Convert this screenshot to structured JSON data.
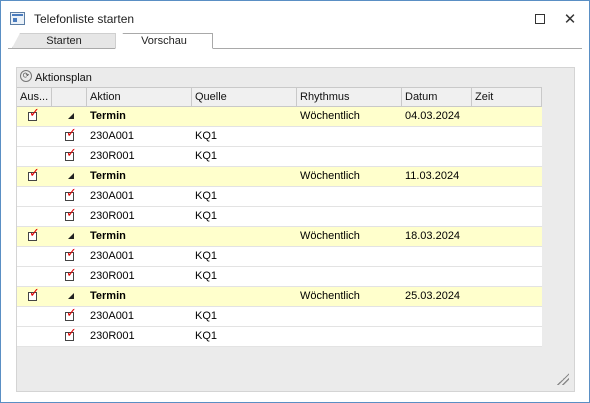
{
  "window": {
    "title": "Telefonliste starten",
    "maximize_icon": "maximize-icon",
    "close_icon": "close-icon",
    "close_glyph": "✕"
  },
  "tabs": [
    {
      "label": "Starten",
      "active": false
    },
    {
      "label": "Vorschau",
      "active": true
    }
  ],
  "panel": {
    "title": "Aktionsplan",
    "icon": "actionplan-icon"
  },
  "grid": {
    "headers": [
      "Aus...",
      "",
      "Aktion",
      "Quelle",
      "Rhythmus",
      "Datum",
      "Zeit"
    ],
    "groups": [
      {
        "checked": true,
        "aktion": "Termin",
        "rhythmus": "Wöchentlich",
        "datum": "04.03.2024",
        "items": [
          {
            "checked": true,
            "aktion": "230A001",
            "quelle": "KQ1"
          },
          {
            "checked": true,
            "aktion": "230R001",
            "quelle": "KQ1"
          }
        ]
      },
      {
        "checked": true,
        "aktion": "Termin",
        "rhythmus": "Wöchentlich",
        "datum": "11.03.2024",
        "items": [
          {
            "checked": true,
            "aktion": "230A001",
            "quelle": "KQ1"
          },
          {
            "checked": true,
            "aktion": "230R001",
            "quelle": "KQ1"
          }
        ]
      },
      {
        "checked": true,
        "aktion": "Termin",
        "rhythmus": "Wöchentlich",
        "datum": "18.03.2024",
        "items": [
          {
            "checked": true,
            "aktion": "230A001",
            "quelle": "KQ1"
          },
          {
            "checked": true,
            "aktion": "230R001",
            "quelle": "KQ1"
          }
        ]
      },
      {
        "checked": true,
        "aktion": "Termin",
        "rhythmus": "Wöchentlich",
        "datum": "25.03.2024",
        "items": [
          {
            "checked": true,
            "aktion": "230A001",
            "quelle": "KQ1"
          },
          {
            "checked": true,
            "aktion": "230R001",
            "quelle": "KQ1"
          }
        ]
      }
    ]
  },
  "colors": {
    "group_row": "#ffffcc",
    "check_mark": "#e00000",
    "window_border": "#5a8fc4"
  }
}
